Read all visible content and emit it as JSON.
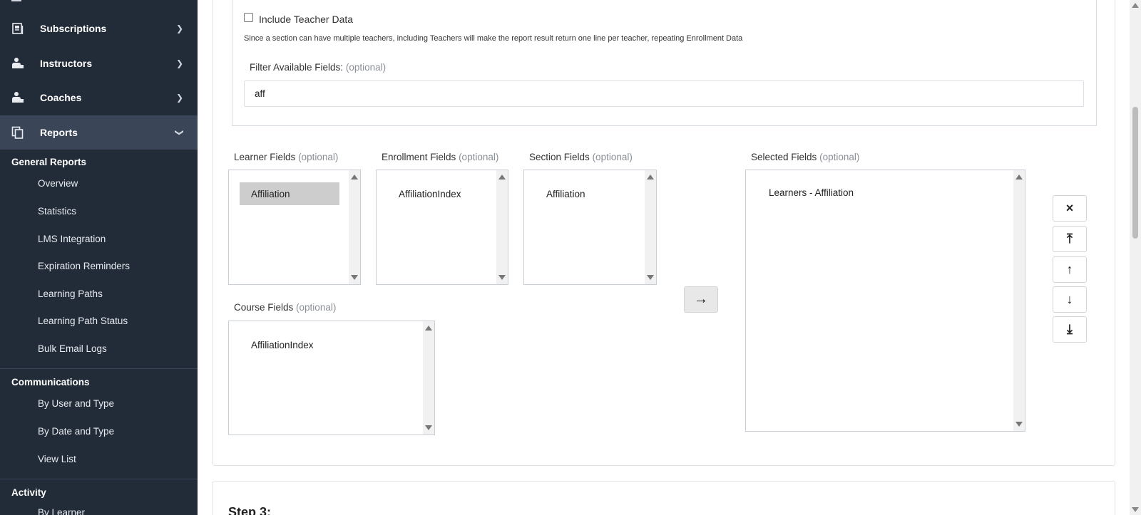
{
  "sidebar": {
    "nav": [
      {
        "label": "Subscriptions",
        "icon": "subscriptions-icon"
      },
      {
        "label": "Instructors",
        "icon": "instructor-icon"
      },
      {
        "label": "Coaches",
        "icon": "coach-icon"
      },
      {
        "label": "Reports",
        "icon": "reports-icon"
      }
    ],
    "general_reports": {
      "heading": "General Reports",
      "items": [
        "Overview",
        "Statistics",
        "LMS Integration",
        "Expiration Reminders",
        "Learning Paths",
        "Learning Path Status",
        "Bulk Email Logs"
      ]
    },
    "communications": {
      "heading": "Communications",
      "items": [
        "By User and Type",
        "By Date and Type",
        "View List"
      ]
    },
    "activity": {
      "heading": "Activity",
      "items": [
        "By Learner"
      ]
    }
  },
  "main": {
    "include_teacher_label": "Include Teacher Data",
    "include_teacher_checked": false,
    "teacher_note": "Since a section can have multiple teachers, including Teachers will make the report result return one line per teacher, repeating Enrollment Data",
    "filter_label": "Filter Available Fields:",
    "optional": "(optional)",
    "filter_value": "aff",
    "learner_fields": {
      "label": "Learner Fields",
      "items": [
        "Affiliation"
      ]
    },
    "enrollment_fields": {
      "label": "Enrollment Fields",
      "items": [
        "AffiliationIndex"
      ]
    },
    "section_fields": {
      "label": "Section Fields",
      "items": [
        "Affiliation"
      ]
    },
    "course_fields": {
      "label": "Course Fields",
      "items": [
        "AffiliationIndex"
      ]
    },
    "selected_fields": {
      "label": "Selected Fields",
      "items": [
        "Learners - Affiliation"
      ]
    },
    "move_button": "→",
    "side_buttons": [
      "×",
      "⤒",
      "↑",
      "↓",
      "⤓"
    ],
    "step3_title": "Step 3:"
  }
}
